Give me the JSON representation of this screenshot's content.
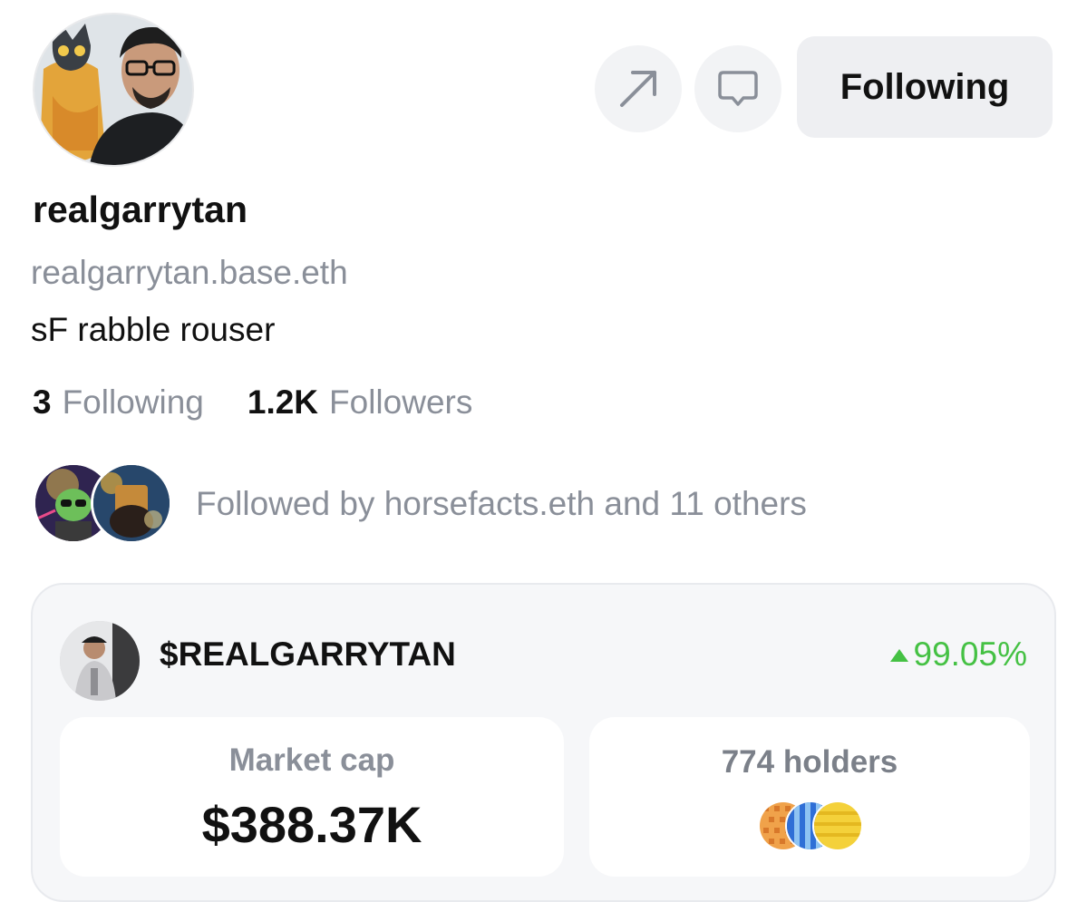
{
  "profile": {
    "display_name": "realgarrytan",
    "handle": "realgarrytan.base.eth",
    "bio": "sF rabble rouser"
  },
  "actions": {
    "follow_label": "Following",
    "share_icon": "arrow-up-right-icon",
    "message_icon": "chat-bubble-icon"
  },
  "stats": {
    "following_count": "3",
    "following_label": "Following",
    "followers_count": "1.2K",
    "followers_label": "Followers"
  },
  "mutuals": {
    "text": "Followed by horsefacts.eth and 11 others"
  },
  "token": {
    "name": "$REALGARRYTAN",
    "change": "99.05%",
    "change_direction": "up",
    "change_color": "#45c144",
    "market_cap_label": "Market cap",
    "market_cap_value": "$388.37K",
    "holders_label": "774 holders"
  }
}
